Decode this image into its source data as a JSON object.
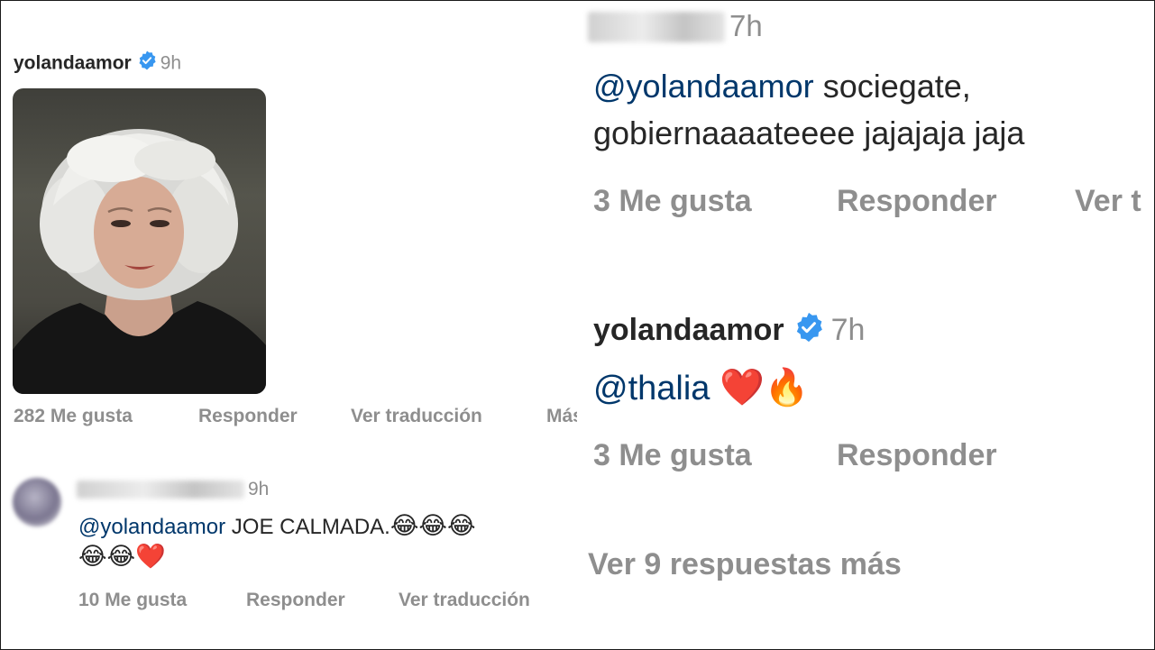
{
  "left": {
    "post": {
      "username": "yolandaamor",
      "time": "9h",
      "likes": "282 Me gusta",
      "reply": "Responder",
      "translate": "Ver traducción",
      "more": "Más"
    },
    "comment": {
      "time": "9h",
      "mention": "@yolandaamor",
      "text": "JOE CALMADA.",
      "emojis_line1": "😂😂😂",
      "emojis_line2": "😂😂❤️",
      "likes": "10 Me gusta",
      "reply": "Responder",
      "translate": "Ver traducción"
    }
  },
  "right": {
    "comment1": {
      "time": "7h",
      "mention": "@yolandaamor",
      "text_line1": "sociegate,",
      "text_line2": "gobiernaaaateeee jajajaja jaja",
      "likes": "3 Me gusta",
      "reply": "Responder",
      "more": "Ver t"
    },
    "comment2": {
      "username": "yolandaamor",
      "time": "7h",
      "mention": "@thalia",
      "emojis": "❤️🔥",
      "likes": "3 Me gusta",
      "reply": "Responder"
    },
    "view_more": "Ver 9 respuestas más"
  },
  "colors": {
    "verified_blue": "#3897f0",
    "mention_blue": "#00376b",
    "meta_gray": "#8e8e8e",
    "text_dark": "#262626"
  },
  "icons": [
    "verified-badge-icon"
  ]
}
